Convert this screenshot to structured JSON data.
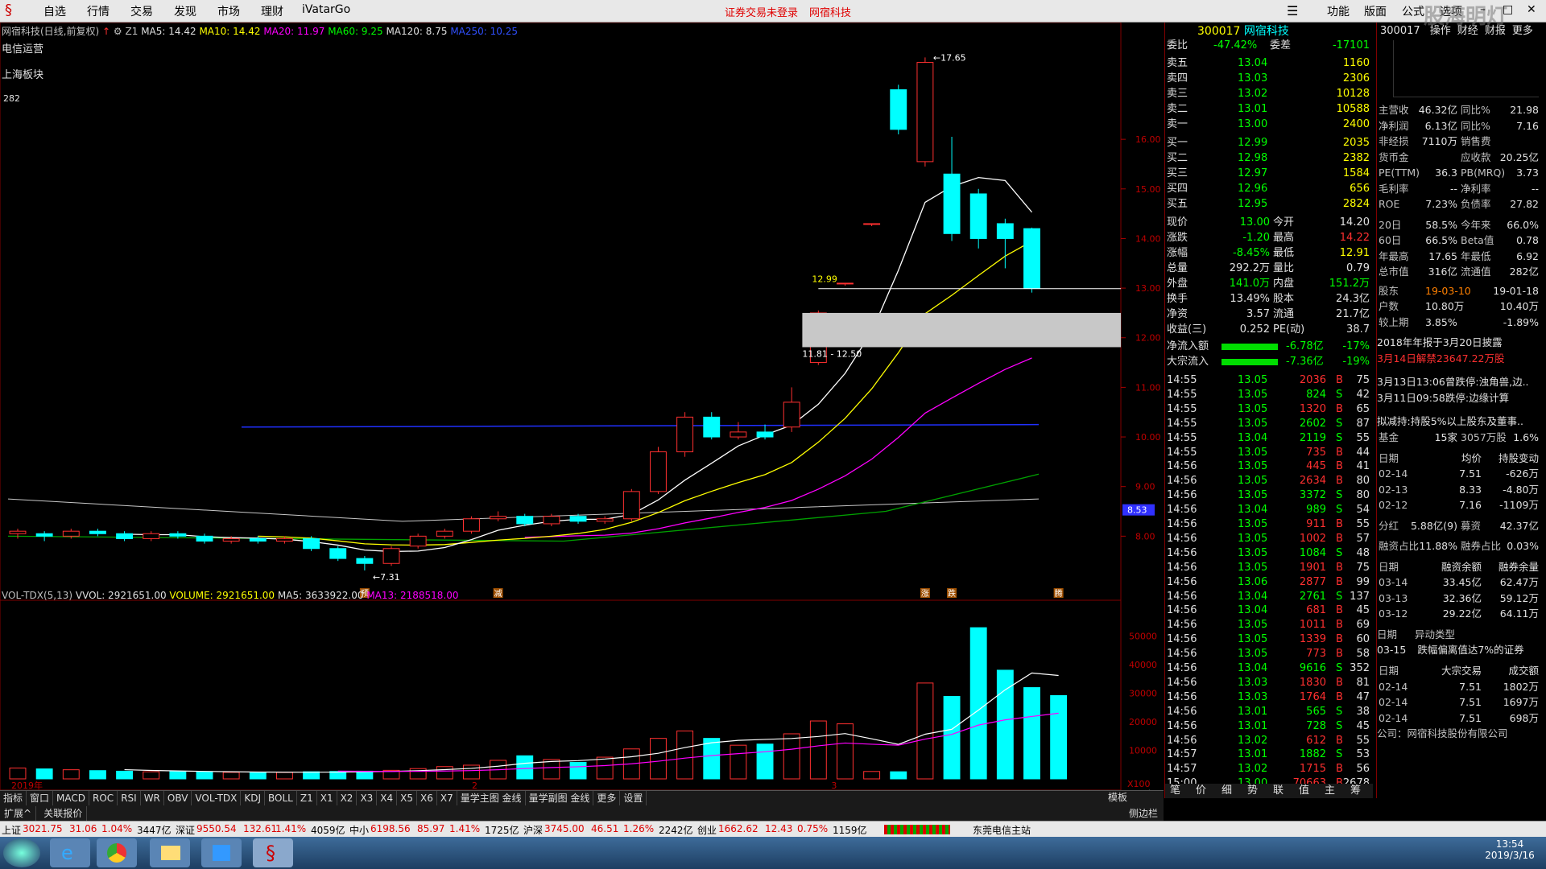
{
  "menu": {
    "items": [
      "自选",
      "行情",
      "交易",
      "发现",
      "市场",
      "理财",
      "iVatarGo"
    ],
    "notice": "证券交易未登录",
    "stock_name": "网宿科技",
    "right_items": [
      "功能",
      "版面",
      "公式",
      "选项"
    ],
    "watermark": "股海明灯"
  },
  "chart_header": {
    "name": "网宿科技(日线,前复权)",
    "z": "Z1",
    "ma5": "MA5: 14.42",
    "ma10": "MA10: 14.42",
    "ma20": "MA20: 11.97",
    "ma60": "MA60: 9.25",
    "ma120": "MA120: 8.75",
    "ma250": "MA250: 10.25"
  },
  "side_labels": [
    "电信运营",
    "上海板块",
    "282"
  ],
  "price_axis": [
    "16.00",
    "15.00",
    "14.00",
    "13.00",
    "12.00",
    "11.00",
    "10.00",
    "9.00",
    "8.00"
  ],
  "price_marker": "8.53",
  "annotations": {
    "high": "17.65",
    "low": "7.31",
    "line_price": "12.99",
    "zone": "11.81 - 12.50"
  },
  "event_markers": [
    "预",
    "减",
    "涨",
    "跌",
    "腾"
  ],
  "vol_header": {
    "name": "VOL-TDX(5,13)",
    "vvol": "VVOL: 2921651.00",
    "volume": "VOLUME: 2921651.00",
    "ma5": "MA5: 3633922.00",
    "ma13": "MA13: 2188518.00"
  },
  "vol_axis": [
    "50000",
    "40000",
    "30000",
    "20000",
    "10000",
    "X100"
  ],
  "time_labels": [
    "2019年",
    "2",
    "3"
  ],
  "period_label": "日线",
  "tabs": [
    "指标",
    "窗口",
    "MACD",
    "ROC",
    "RSI",
    "WR",
    "OBV",
    "VOL-TDX",
    "KDJ",
    "BOLL",
    "Z1",
    "X1",
    "X2",
    "X3",
    "X4",
    "X5",
    "X6",
    "X7",
    "量学主图 金线",
    "量学副图 金线",
    "更多",
    "设置"
  ],
  "tabs2": [
    "扩展^",
    "关联报价"
  ],
  "tabs_right": [
    "模板",
    "侧边栏"
  ],
  "quote": {
    "code": "300017",
    "name": "网宿科技",
    "weibi": {
      "label": "委比",
      "value": "-47.42%",
      "diff_label": "委差",
      "diff": "-17101"
    },
    "asks": [
      {
        "label": "卖五",
        "price": "13.04",
        "vol": "1160"
      },
      {
        "label": "卖四",
        "price": "13.03",
        "vol": "2306"
      },
      {
        "label": "卖三",
        "price": "13.02",
        "vol": "10128"
      },
      {
        "label": "卖二",
        "price": "13.01",
        "vol": "10588"
      },
      {
        "label": "卖一",
        "price": "13.00",
        "vol": "2400"
      }
    ],
    "bids": [
      {
        "label": "买一",
        "price": "12.99",
        "vol": "2035"
      },
      {
        "label": "买二",
        "price": "12.98",
        "vol": "2382"
      },
      {
        "label": "买三",
        "price": "12.97",
        "vol": "1584"
      },
      {
        "label": "买四",
        "price": "12.96",
        "vol": "656"
      },
      {
        "label": "买五",
        "price": "12.95",
        "vol": "2824"
      }
    ],
    "stats": [
      [
        "现价",
        "13.00",
        "今开",
        "14.20"
      ],
      [
        "涨跌",
        "-1.20",
        "最高",
        "14.22"
      ],
      [
        "涨幅",
        "-8.45%",
        "最低",
        "12.91"
      ],
      [
        "总量",
        "292.2万",
        "量比",
        "0.79"
      ],
      [
        "外盘",
        "141.0万",
        "内盘",
        "151.2万"
      ],
      [
        "换手",
        "13.49%",
        "股本",
        "24.3亿"
      ],
      [
        "净资",
        "3.57",
        "流通",
        "21.7亿"
      ],
      [
        "收益(三)",
        "0.252",
        "PE(动)",
        "38.7"
      ]
    ],
    "flows": [
      [
        "净流入额",
        "-6.78亿",
        "-17%"
      ],
      [
        "大宗流入",
        "-7.36亿",
        "-19%"
      ]
    ],
    "ticks": [
      [
        "14:55",
        "13.05",
        "2036",
        "B",
        "75"
      ],
      [
        "14:55",
        "13.05",
        "824",
        "S",
        "42"
      ],
      [
        "14:55",
        "13.05",
        "1320",
        "B",
        "65"
      ],
      [
        "14:55",
        "13.05",
        "2602",
        "S",
        "87"
      ],
      [
        "14:55",
        "13.04",
        "2119",
        "S",
        "55"
      ],
      [
        "14:55",
        "13.05",
        "735",
        "B",
        "44"
      ],
      [
        "14:56",
        "13.05",
        "445",
        "B",
        "41"
      ],
      [
        "14:56",
        "13.05",
        "2634",
        "B",
        "80"
      ],
      [
        "14:56",
        "13.05",
        "3372",
        "S",
        "80"
      ],
      [
        "14:56",
        "13.04",
        "989",
        "S",
        "54"
      ],
      [
        "14:56",
        "13.05",
        "911",
        "B",
        "55"
      ],
      [
        "14:56",
        "13.05",
        "1002",
        "B",
        "57"
      ],
      [
        "14:56",
        "13.05",
        "1084",
        "S",
        "48"
      ],
      [
        "14:56",
        "13.05",
        "1901",
        "B",
        "75"
      ],
      [
        "14:56",
        "13.06",
        "2877",
        "B",
        "99"
      ],
      [
        "14:56",
        "13.04",
        "2761",
        "S",
        "137"
      ],
      [
        "14:56",
        "13.04",
        "681",
        "B",
        "45"
      ],
      [
        "14:56",
        "13.05",
        "1011",
        "B",
        "69"
      ],
      [
        "14:56",
        "13.05",
        "1339",
        "B",
        "60"
      ],
      [
        "14:56",
        "13.05",
        "773",
        "B",
        "58"
      ],
      [
        "14:56",
        "13.04",
        "9616",
        "S",
        "352"
      ],
      [
        "14:56",
        "13.03",
        "1830",
        "B",
        "81"
      ],
      [
        "14:56",
        "13.03",
        "1764",
        "B",
        "47"
      ],
      [
        "14:56",
        "13.01",
        "565",
        "S",
        "38"
      ],
      [
        "14:56",
        "13.01",
        "728",
        "S",
        "45"
      ],
      [
        "14:56",
        "13.02",
        "612",
        "B",
        "55"
      ],
      [
        "14:57",
        "13.01",
        "1882",
        "S",
        "53"
      ],
      [
        "14:57",
        "13.02",
        "1715",
        "B",
        "56"
      ],
      [
        "15:00",
        "13.00",
        "70663",
        "B",
        "2678"
      ]
    ],
    "bottom_tabs": [
      "笔",
      "价",
      "细",
      "势",
      "联",
      "值",
      "主",
      "筹"
    ]
  },
  "f10": {
    "code": "300017",
    "tabs": [
      "操作",
      "财经",
      "财报",
      "更多"
    ],
    "fin": [
      [
        "主营收",
        "46.32亿",
        "同比%",
        "21.98"
      ],
      [
        "净利润",
        "6.13亿",
        "同比%",
        "7.16"
      ],
      [
        "非经损",
        "7110万",
        "销售费",
        ""
      ],
      [
        "货币金",
        "",
        "应收款",
        "20.25亿"
      ],
      [
        "PE(TTM)",
        "36.3",
        "PB(MRQ)",
        "3.73"
      ],
      [
        "毛利率",
        "--",
        "净利率",
        "--"
      ],
      [
        "ROE",
        "7.23%",
        "负债率",
        "27.82"
      ],
      [
        "20日",
        "58.5%",
        "今年来",
        "66.0%"
      ],
      [
        "60日",
        "66.5%",
        "Beta值",
        "0.78"
      ],
      [
        "年最高",
        "17.65",
        "年最低",
        "6.92"
      ],
      [
        "总市值",
        "316亿",
        "流通值",
        "282亿"
      ]
    ],
    "holders": [
      [
        "股东",
        "19-03-10",
        "19-01-18"
      ],
      [
        "户数",
        "10.80万",
        "10.40万"
      ],
      [
        "较上期",
        "3.85%",
        "-1.89%"
      ]
    ],
    "news": [
      "2018年年报于3月20日披露",
      "3月14日解禁23647.22万股",
      "3月13日13:06曾跌停:浊角兽,边..",
      "3月11日09:58跌停:边缘计算",
      "拟减持:持股5%以上股东及董事.."
    ],
    "fund": [
      "基金",
      "15家",
      "3057万股",
      "1.6%"
    ],
    "trades_head": [
      "日期",
      "均价",
      "持股变动"
    ],
    "trades": [
      [
        "02-14",
        "7.51",
        "-626万"
      ],
      [
        "02-13",
        "8.33",
        "-4.80万"
      ],
      [
        "02-12",
        "7.16",
        "-1109万"
      ]
    ],
    "dividend": [
      "分红",
      "5.88亿(9)",
      "募资",
      "42.37亿"
    ],
    "margin_ratio": [
      "融资占比",
      "11.88%",
      "融券占比",
      "0.03%"
    ],
    "margin_head": [
      "日期",
      "融资余额",
      "融券余量"
    ],
    "margin": [
      [
        "03-14",
        "33.45亿",
        "62.47万"
      ],
      [
        "03-13",
        "32.36亿",
        "59.12万"
      ],
      [
        "03-12",
        "29.22亿",
        "64.11万"
      ]
    ],
    "abnormal_head": [
      "日期",
      "异动类型"
    ],
    "abnormal": [
      [
        "03-15",
        "跌幅偏离值达7%的证券"
      ]
    ],
    "block_head": [
      "日期",
      "大宗交易",
      "成交额"
    ],
    "block": [
      [
        "02-14",
        "7.51",
        "1802万"
      ],
      [
        "02-14",
        "7.51",
        "1697万"
      ],
      [
        "02-14",
        "7.51",
        "698万"
      ]
    ],
    "company": "公司：网宿科技股份有限公司"
  },
  "index_bar": {
    "items": [
      {
        "name": "上证",
        "val": "3021.75",
        "chg": "31.06",
        "pct": "1.04%",
        "amt": "3447亿"
      },
      {
        "name": "深证",
        "val": "9550.54",
        "chg": "132.61",
        "pct": "1.41%",
        "amt": "4059亿"
      },
      {
        "name": "中小",
        "val": "6198.56",
        "chg": "85.97",
        "pct": "1.41%",
        "amt": "1725亿"
      },
      {
        "name": "沪深",
        "val": "3745.00",
        "chg": "46.51",
        "pct": "1.26%",
        "amt": "2242亿"
      },
      {
        "name": "创业",
        "val": "1662.62",
        "chg": "12.43",
        "pct": "0.75%",
        "amt": "1159亿"
      }
    ],
    "server": "东莞电信主站"
  },
  "taskbar": {
    "time": "13:54",
    "date": "2019/3/16"
  },
  "chart_data": {
    "type": "candlestick",
    "price_range": [
      7.0,
      17.9
    ],
    "candles": [
      [
        8.05,
        8.1,
        7.95,
        8.15
      ],
      [
        8.05,
        8.0,
        7.9,
        8.1
      ],
      [
        8.0,
        8.1,
        7.95,
        8.15
      ],
      [
        8.1,
        8.05,
        8.0,
        8.15
      ],
      [
        8.05,
        7.95,
        7.9,
        8.1
      ],
      [
        7.95,
        8.05,
        7.9,
        8.1
      ],
      [
        8.05,
        8.0,
        7.95,
        8.1
      ],
      [
        8.0,
        7.9,
        7.85,
        8.05
      ],
      [
        7.9,
        7.95,
        7.85,
        8.0
      ],
      [
        7.95,
        7.9,
        7.85,
        8.0
      ],
      [
        7.9,
        7.95,
        7.85,
        8.0
      ],
      [
        7.95,
        7.75,
        7.7,
        8.0
      ],
      [
        7.75,
        7.55,
        7.5,
        7.8
      ],
      [
        7.55,
        7.45,
        7.31,
        7.6
      ],
      [
        7.45,
        7.75,
        7.4,
        7.8
      ],
      [
        7.8,
        8.0,
        7.75,
        8.05
      ],
      [
        8.0,
        8.1,
        7.95,
        8.15
      ],
      [
        8.1,
        8.35,
        8.05,
        8.4
      ],
      [
        8.35,
        8.4,
        8.3,
        8.5
      ],
      [
        8.4,
        8.25,
        8.2,
        8.45
      ],
      [
        8.25,
        8.4,
        8.2,
        8.45
      ],
      [
        8.4,
        8.3,
        8.25,
        8.45
      ],
      [
        8.3,
        8.35,
        8.25,
        8.4
      ],
      [
        8.35,
        8.9,
        8.3,
        8.95
      ],
      [
        8.9,
        9.7,
        8.85,
        9.8
      ],
      [
        9.7,
        10.4,
        9.6,
        10.5
      ],
      [
        10.4,
        10.0,
        9.95,
        10.5
      ],
      [
        10.0,
        10.1,
        9.95,
        10.3
      ],
      [
        10.1,
        10.0,
        9.95,
        10.25
      ],
      [
        10.2,
        10.7,
        10.1,
        11.0
      ],
      [
        11.5,
        12.5,
        11.45,
        12.55
      ],
      [
        13.1,
        13.1,
        13.05,
        13.1
      ],
      [
        14.3,
        14.3,
        14.25,
        14.3
      ],
      [
        17.0,
        16.2,
        16.1,
        17.1
      ],
      [
        15.55,
        17.55,
        15.45,
        17.65
      ],
      [
        15.3,
        14.1,
        13.95,
        16.05
      ],
      [
        14.9,
        14.0,
        13.8,
        15.0
      ],
      [
        14.3,
        14.0,
        13.4,
        14.4
      ],
      [
        14.2,
        13.0,
        12.91,
        14.22
      ]
    ],
    "volume_max": 55000,
    "volumes": [
      3800,
      3500,
      3200,
      2900,
      2700,
      2500,
      2600,
      2400,
      2300,
      2200,
      2300,
      2500,
      2600,
      2700,
      3000,
      3600,
      4300,
      4800,
      6500,
      8100,
      6800,
      5800,
      7600,
      10500,
      14200,
      16800,
      14200,
      11800,
      12200,
      15800,
      20300,
      19300,
      2600,
      2500,
      33600,
      28900,
      53000,
      38100,
      32000,
      29200
    ]
  }
}
